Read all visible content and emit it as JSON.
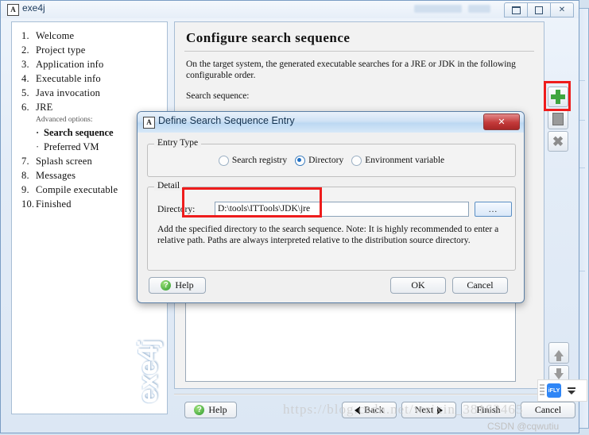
{
  "window": {
    "title": "exe4j",
    "icon": "A",
    "controls": [
      {
        "name": "minimize",
        "label": ""
      },
      {
        "name": "maximize",
        "label": ""
      },
      {
        "name": "close",
        "label": "✕"
      }
    ]
  },
  "sidebar": {
    "items": [
      {
        "num": "1.",
        "label": "Welcome"
      },
      {
        "num": "2.",
        "label": "Project type"
      },
      {
        "num": "3.",
        "label": "Application info"
      },
      {
        "num": "4.",
        "label": "Executable info"
      },
      {
        "num": "5.",
        "label": "Java invocation"
      },
      {
        "num": "6.",
        "label": "JRE"
      }
    ],
    "sub_heading": "Advanced options:",
    "sub_items": [
      {
        "bullet": "·",
        "label": "Search sequence",
        "active": true
      },
      {
        "bullet": "·",
        "label": "Preferred VM",
        "active": false
      }
    ],
    "items_after": [
      {
        "num": "7.",
        "label": "Splash screen"
      },
      {
        "num": "8.",
        "label": "Messages"
      },
      {
        "num": "9.",
        "label": "Compile executable"
      },
      {
        "num": "10.",
        "label": "Finished"
      }
    ],
    "brand": "exe4j"
  },
  "content": {
    "title": "Configure search sequence",
    "description": "On the target system, the generated executable searches for a JRE or JDK in the following configurable order.",
    "sequence_label": "Search sequence:",
    "sequence_items": []
  },
  "side_tools": [
    {
      "name": "add",
      "icon": "plus-icon"
    },
    {
      "name": "duplicate",
      "icon": "copy-icon"
    },
    {
      "name": "remove",
      "icon": "x-icon"
    }
  ],
  "move_tools": [
    {
      "name": "move-up",
      "icon": "arrow-up-icon"
    },
    {
      "name": "move-down",
      "icon": "arrow-down-icon"
    }
  ],
  "footer": {
    "help": "Help",
    "back": "Back",
    "next": "Next",
    "finish": "Finish",
    "cancel": "Cancel"
  },
  "dialog": {
    "icon": "A",
    "title": "Define Search Sequence Entry",
    "close_label": "✕",
    "entry_type": {
      "legend": "Entry Type",
      "options": [
        {
          "label": "Search registry",
          "selected": false
        },
        {
          "label": "Directory",
          "selected": true
        },
        {
          "label": "Environment variable",
          "selected": false
        }
      ]
    },
    "detail": {
      "legend": "Detail",
      "directory_label": "Directory:",
      "directory_value": "D:\\tools\\ITTools\\JDK\\jre",
      "browse_label": "...",
      "note": "Add the specified directory to the search sequence. Note: It is highly recommended to enter a relative path. Paths are always interpreted relative to the distribution source directory."
    },
    "buttons": {
      "help": "Help",
      "ok": "OK",
      "cancel": "Cancel"
    }
  },
  "watermarks": {
    "url": "https://blog.csdn.net/weixin_38163465",
    "credit": "CSDN @cqwutiu"
  },
  "ime": {
    "logo": "iFLY"
  },
  "colors": {
    "accent_green": "#3fa53f",
    "annotation_red": "#ee1c1c",
    "close_red": "#c33a3a",
    "radio_blue": "#1f6fc4"
  }
}
